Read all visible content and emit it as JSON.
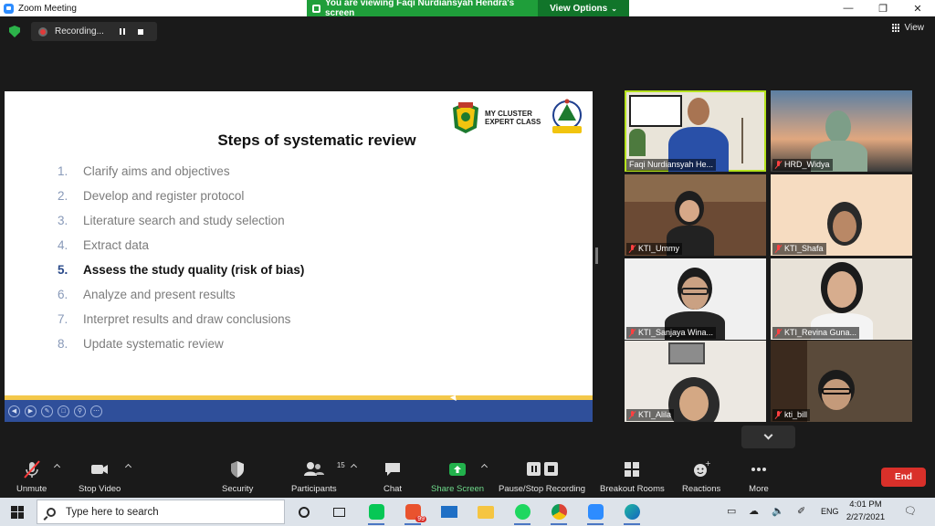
{
  "window": {
    "title": "Zoom Meeting",
    "viewing_banner": "You are viewing Faqi Nurdiansyah Hendra's screen",
    "view_options": "View Options"
  },
  "recording": {
    "label": "Recording..."
  },
  "view_button": {
    "label": "View"
  },
  "slide": {
    "title": "Steps of systematic review",
    "logo_text": "MY CLUSTER\nEXPERT CLASS",
    "steps": [
      {
        "num": "1.",
        "text": "Clarify aims and objectives"
      },
      {
        "num": "2.",
        "text": "Develop and register protocol"
      },
      {
        "num": "3.",
        "text": "Literature search and study selection"
      },
      {
        "num": "4.",
        "text": "Extract data"
      },
      {
        "num": "5.",
        "text": "Assess the study quality (risk of bias)"
      },
      {
        "num": "6.",
        "text": "Analyze and present results"
      },
      {
        "num": "7.",
        "text": "Interpret results and draw conclusions"
      },
      {
        "num": "8.",
        "text": "Update systematic review"
      }
    ],
    "active_step": 5
  },
  "participants": [
    {
      "name": "Faqi Nurdiansyah He...",
      "muted": false
    },
    {
      "name": "HRD_Widya",
      "muted": true
    },
    {
      "name": "KTI_Ummy",
      "muted": true
    },
    {
      "name": "KTI_Shafa",
      "muted": true
    },
    {
      "name": "KTI_Sanjaya Wina...",
      "muted": true
    },
    {
      "name": "KTI_Revina Guna...",
      "muted": true
    },
    {
      "name": "KTI_Alila",
      "muted": true
    },
    {
      "name": "kti_bill",
      "muted": true
    }
  ],
  "toolbar": {
    "unmute": "Unmute",
    "stop_video": "Stop Video",
    "security": "Security",
    "participants": "Participants",
    "participants_count": "15",
    "chat": "Chat",
    "share_screen": "Share Screen",
    "pause_stop_recording": "Pause/Stop Recording",
    "breakout_rooms": "Breakout Rooms",
    "reactions": "Reactions",
    "more": "More",
    "end": "End"
  },
  "taskbar": {
    "search_placeholder": "Type here to search",
    "notification_count": "99",
    "language": "ENG",
    "time": "4:01 PM",
    "date": "2/27/2021"
  },
  "colors": {
    "zoom_green": "#1f9e3a",
    "speaking_outline": "#b5e21d",
    "share_green": "#22b14c",
    "end_red": "#d9302a",
    "slide_bar": "#2f4f9a",
    "slide_line": "#f4c84a"
  }
}
